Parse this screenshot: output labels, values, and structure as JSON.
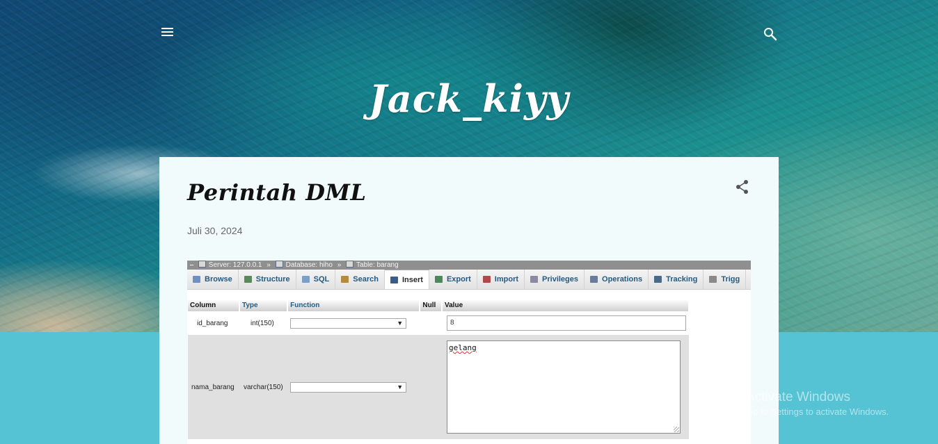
{
  "blog": {
    "title": "Jack_kiyy"
  },
  "header": {
    "menu_icon": "hamburger-menu-icon",
    "search_icon": "search-icon"
  },
  "post": {
    "title": "Perintah DML",
    "date": "Juli 30, 2024",
    "share_icon": "share-icon"
  },
  "screenshot": {
    "breadcrumb": {
      "server": "Server: 127.0.0.1",
      "database": "Database: hiho",
      "table": "Table: barang",
      "separator": "»"
    },
    "tabs": [
      {
        "label": "Browse",
        "icon": "browse-icon",
        "color": "#6d8fc1"
      },
      {
        "label": "Structure",
        "icon": "structure-icon",
        "color": "#5a8a5a"
      },
      {
        "label": "SQL",
        "icon": "sql-icon",
        "color": "#7aa0c8"
      },
      {
        "label": "Search",
        "icon": "search-icon",
        "color": "#b48a3c"
      },
      {
        "label": "Insert",
        "icon": "insert-icon",
        "color": "#3a5c8c",
        "active": true
      },
      {
        "label": "Export",
        "icon": "export-icon",
        "color": "#4a8a5a"
      },
      {
        "label": "Import",
        "icon": "import-icon",
        "color": "#b04a4a"
      },
      {
        "label": "Privileges",
        "icon": "privileges-icon",
        "color": "#8a8aa0"
      },
      {
        "label": "Operations",
        "icon": "operations-icon",
        "color": "#6a7a9a"
      },
      {
        "label": "Tracking",
        "icon": "tracking-icon",
        "color": "#4a6a8a"
      },
      {
        "label": "Trigg",
        "icon": "triggers-icon",
        "color": "#8a8a8a"
      }
    ],
    "table": {
      "headers": [
        "Column",
        "Type",
        "Function",
        "Null",
        "Value"
      ],
      "rows": [
        {
          "column": "id_barang",
          "type": "int(150)",
          "function": "",
          "value": "8"
        },
        {
          "column": "nama_barang",
          "type": "varchar(150)",
          "function": "",
          "value": "gelang"
        }
      ]
    }
  },
  "watermark": {
    "title": "Activate Windows",
    "subtitle": "Go to Settings to activate Windows."
  }
}
